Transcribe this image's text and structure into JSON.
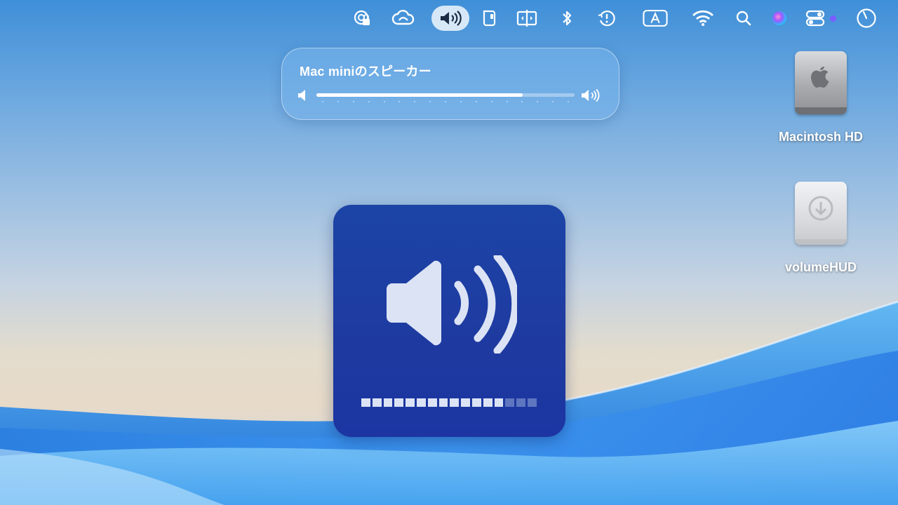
{
  "menubar": {
    "items": [
      {
        "icon": "screen-sharing-lock-icon"
      },
      {
        "icon": "creative-cloud-icon"
      },
      {
        "icon": "volume-icon",
        "active": true
      },
      {
        "icon": "stage-manager-icon"
      },
      {
        "icon": "display-mirroring-icon"
      },
      {
        "icon": "bluetooth-icon"
      },
      {
        "icon": "time-machine-icon"
      },
      {
        "icon": "input-source-icon",
        "label": "A"
      },
      {
        "icon": "wifi-icon"
      },
      {
        "icon": "spotlight-search-icon"
      },
      {
        "icon": "siri-icon"
      },
      {
        "icon": "control-center-icon"
      },
      {
        "icon": "clock-icon"
      }
    ]
  },
  "sound_panel": {
    "title": "Mac miniのスピーカー",
    "volume": 0.8,
    "tick_count": 17
  },
  "desktop_icons": [
    {
      "label": "Macintosh HD",
      "icon": "internal-drive-icon"
    },
    {
      "label": "volumeHUD",
      "icon": "external-drive-download-icon"
    }
  ],
  "volume_hud": {
    "icon": "speaker-wave-icon",
    "total_segments": 16,
    "filled_segments": 13,
    "colors": {
      "background": "#1e3aa0",
      "segment_filled": "#dbe3f5",
      "segment_empty": "#6f86c8"
    }
  }
}
